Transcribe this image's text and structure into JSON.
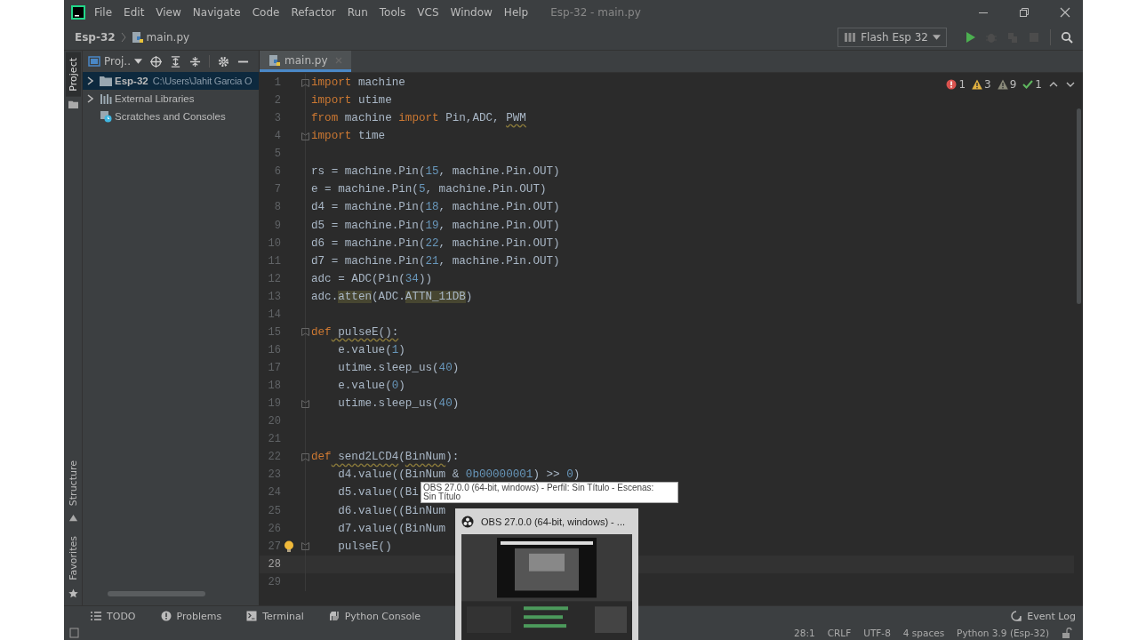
{
  "window": {
    "title": "Esp-32 - main.py"
  },
  "menu": [
    "File",
    "Edit",
    "View",
    "Navigate",
    "Code",
    "Refactor",
    "Run",
    "Tools",
    "VCS",
    "Window",
    "Help"
  ],
  "breadcrumb": [
    "Esp-32",
    "main.py"
  ],
  "run_config": {
    "label": "Flash Esp 32"
  },
  "toolbar": [
    {
      "kind": "run",
      "disabled": false
    },
    {
      "kind": "debug",
      "disabled": true
    },
    {
      "kind": "profile",
      "disabled": true
    },
    {
      "kind": "stop",
      "disabled": true
    }
  ],
  "side_tabs": [
    {
      "label": "Project",
      "selected": true,
      "kind": "project"
    },
    {
      "label": "Structure",
      "selected": false,
      "kind": "structure"
    },
    {
      "label": "Favorites",
      "selected": false,
      "kind": "favorites"
    }
  ],
  "project_panel": {
    "view": "Proj..",
    "items": [
      {
        "kind": "folder",
        "label": "Esp-32",
        "path": "C:\\Users\\Jahit Garcia O",
        "selected": true,
        "expanded": false
      },
      {
        "kind": "library",
        "label": "External Libraries",
        "selected": false,
        "expanded": false
      },
      {
        "kind": "scratches",
        "label": "Scratches and Consoles",
        "selected": false
      }
    ]
  },
  "editor": {
    "tabs": [
      {
        "label": "main.py",
        "selected": true
      }
    ],
    "inspections": [
      {
        "kind": "error",
        "count": "1"
      },
      {
        "kind": "warning",
        "count": "3"
      },
      {
        "kind": "weak",
        "count": "9"
      },
      {
        "kind": "ok",
        "count": "1"
      }
    ],
    "lines": [
      {
        "number": "1",
        "current": false,
        "fold_open": true,
        "tokens": [
          {
            "kind": "kw",
            "text": "import"
          },
          {
            "kind": "plain",
            "text": " machine"
          }
        ]
      },
      {
        "number": "2",
        "current": false,
        "tokens": [
          {
            "kind": "kw",
            "text": "import"
          },
          {
            "kind": "plain",
            "text": " utime"
          }
        ]
      },
      {
        "number": "3",
        "current": false,
        "tokens": [
          {
            "kind": "kw",
            "text": "from"
          },
          {
            "kind": "plain",
            "text": " machine "
          },
          {
            "kind": "kw",
            "text": "import"
          },
          {
            "kind": "plain",
            "text": " Pin,ADC, "
          },
          {
            "kind": "warn",
            "text": "PWM"
          }
        ]
      },
      {
        "number": "4",
        "current": false,
        "fold_close": true,
        "tokens": [
          {
            "kind": "kw",
            "text": "import"
          },
          {
            "kind": "plain",
            "text": " time"
          }
        ]
      },
      {
        "number": "5",
        "current": false
      },
      {
        "number": "6",
        "current": false,
        "tokens": [
          {
            "kind": "plain",
            "text": "rs = machine.Pin("
          },
          {
            "kind": "num",
            "text": "15"
          },
          {
            "kind": "plain",
            "text": ", machine.Pin.OUT)"
          }
        ]
      },
      {
        "number": "7",
        "current": false,
        "tokens": [
          {
            "kind": "plain",
            "text": "e = machine.Pin("
          },
          {
            "kind": "num",
            "text": "5"
          },
          {
            "kind": "plain",
            "text": ", machine.Pin.OUT)"
          }
        ]
      },
      {
        "number": "8",
        "current": false,
        "tokens": [
          {
            "kind": "plain",
            "text": "d4 = machine.Pin("
          },
          {
            "kind": "num",
            "text": "18"
          },
          {
            "kind": "plain",
            "text": ", machine.Pin.OUT)"
          }
        ]
      },
      {
        "number": "9",
        "current": false,
        "tokens": [
          {
            "kind": "plain",
            "text": "d5 = machine.Pin("
          },
          {
            "kind": "num",
            "text": "19"
          },
          {
            "kind": "plain",
            "text": ", machine.Pin.OUT)"
          }
        ]
      },
      {
        "number": "10",
        "current": false,
        "tokens": [
          {
            "kind": "plain",
            "text": "d6 = machine.Pin("
          },
          {
            "kind": "num",
            "text": "22"
          },
          {
            "kind": "plain",
            "text": ", machine.Pin.OUT)"
          }
        ]
      },
      {
        "number": "11",
        "current": false,
        "tokens": [
          {
            "kind": "plain",
            "text": "d7 = machine.Pin("
          },
          {
            "kind": "num",
            "text": "21"
          },
          {
            "kind": "plain",
            "text": ", machine.Pin.OUT)"
          }
        ]
      },
      {
        "number": "12",
        "current": false,
        "tokens": [
          {
            "kind": "plain",
            "text": "adc = ADC(Pin("
          },
          {
            "kind": "num",
            "text": "34"
          },
          {
            "kind": "plain",
            "text": "))"
          }
        ]
      },
      {
        "number": "13",
        "current": false,
        "tokens": [
          {
            "kind": "plain",
            "text": "adc."
          },
          {
            "kind": "hl",
            "text": "atten"
          },
          {
            "kind": "plain",
            "text": "(ADC."
          },
          {
            "kind": "hl",
            "text": "ATTN_11DB"
          },
          {
            "kind": "plain",
            "text": ")"
          }
        ]
      },
      {
        "number": "14",
        "current": false
      },
      {
        "number": "15",
        "current": false,
        "fold_open": true,
        "tokens": [
          {
            "kind": "kw",
            "text": "def"
          },
          {
            "kind": "warn",
            "text": " pulseE():"
          }
        ]
      },
      {
        "number": "16",
        "current": false,
        "tokens": [
          {
            "kind": "plain",
            "text": "    e.value("
          },
          {
            "kind": "num",
            "text": "1"
          },
          {
            "kind": "plain",
            "text": ")"
          }
        ]
      },
      {
        "number": "17",
        "current": false,
        "tokens": [
          {
            "kind": "plain",
            "text": "    utime.sleep_us("
          },
          {
            "kind": "num",
            "text": "40"
          },
          {
            "kind": "plain",
            "text": ")"
          }
        ]
      },
      {
        "number": "18",
        "current": false,
        "tokens": [
          {
            "kind": "plain",
            "text": "    e.value("
          },
          {
            "kind": "num",
            "text": "0"
          },
          {
            "kind": "plain",
            "text": ")"
          }
        ]
      },
      {
        "number": "19",
        "current": false,
        "fold_close": true,
        "tokens": [
          {
            "kind": "plain",
            "text": "    utime.sleep_us("
          },
          {
            "kind": "num",
            "text": "40"
          },
          {
            "kind": "plain",
            "text": ")"
          }
        ]
      },
      {
        "number": "20",
        "current": false
      },
      {
        "number": "21",
        "current": false
      },
      {
        "number": "22",
        "current": false,
        "fold_open": true,
        "tokens": [
          {
            "kind": "kw",
            "text": "def"
          },
          {
            "kind": "warn",
            "text": " send2LCD4"
          },
          {
            "kind": "plain",
            "text": "("
          },
          {
            "kind": "warn",
            "text": "BinNum"
          },
          {
            "kind": "plain",
            "text": "):"
          }
        ]
      },
      {
        "number": "23",
        "current": false,
        "tokens": [
          {
            "kind": "plain",
            "text": "    d4.value((BinNum & "
          },
          {
            "kind": "num",
            "text": "0b00000001"
          },
          {
            "kind": "plain",
            "text": ") >> "
          },
          {
            "kind": "num",
            "text": "0"
          },
          {
            "kind": "plain",
            "text": ")"
          }
        ]
      },
      {
        "number": "24",
        "current": false,
        "tokens": [
          {
            "kind": "plain",
            "text": "    d5.value((Bi"
          }
        ]
      },
      {
        "number": "25",
        "current": false,
        "tokens": [
          {
            "kind": "plain",
            "text": "    d6.value((BinNum"
          }
        ]
      },
      {
        "number": "26",
        "current": false,
        "tokens": [
          {
            "kind": "plain",
            "text": "    d7.value((BinNum"
          }
        ]
      },
      {
        "number": "27",
        "current": false,
        "fold_close": true,
        "bulb": true,
        "tokens": [
          {
            "kind": "plain",
            "text": "    pulseE()"
          }
        ]
      },
      {
        "number": "28",
        "current": true
      },
      {
        "number": "29",
        "current": false
      }
    ]
  },
  "tooltip": {
    "lines": [
      "OBS 27.0.0 (64-bit, windows) - Perfil: Sin Título - Escenas:",
      "Sin Título"
    ]
  },
  "taskbar_preview": {
    "title": "OBS 27.0.0 (64-bit, windows) - ..."
  },
  "tool_tabs": [
    {
      "kind": "todo",
      "label": "TODO"
    },
    {
      "kind": "problems",
      "label": "Problems"
    },
    {
      "kind": "terminal",
      "label": "Terminal"
    },
    {
      "kind": "python",
      "label": "Python Console"
    }
  ],
  "event_log": "Event Log",
  "status_bar": [
    "28:1",
    "CRLF",
    "UTF-8",
    "4 spaces",
    "Python 3.9 (Esp-32)"
  ]
}
